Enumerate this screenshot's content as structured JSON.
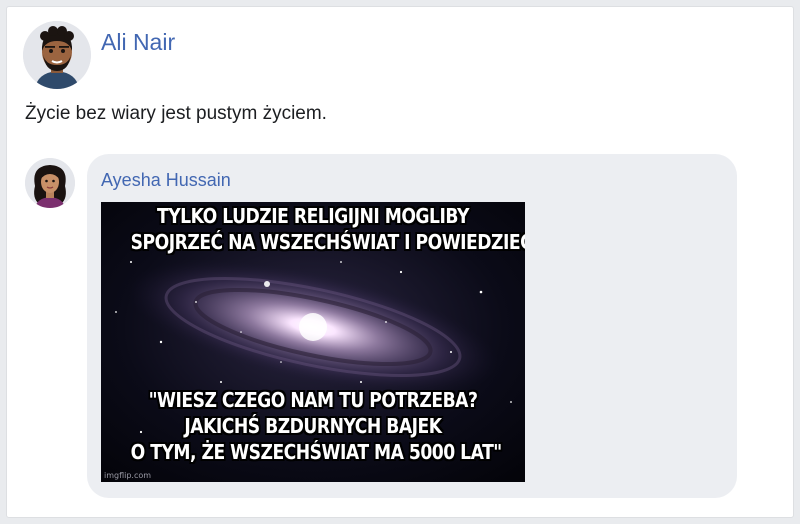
{
  "post": {
    "author": "Ali Nair",
    "text": "Życie bez wiary jest pustym życiem."
  },
  "comment": {
    "author": "Ayesha Hussain",
    "meme": {
      "top_lines": [
        "TYLKO LUDZIE RELIGIJNI MOGLIBY",
        "SPOJRZEĆ NA WSZECHŚWIAT I POWIEDZIEĆ:"
      ],
      "bottom_lines": [
        "\"WIESZ CZEGO NAM TU POTRZEBA?",
        "JAKICHŚ BZDURNYCH BAJEK",
        "O TYM, ŻE WSZECHŚWIAT MA 5000 LAT\""
      ],
      "watermark": "imgflip.com"
    }
  },
  "colors": {
    "link": "#4267b2",
    "text": "#1c1e21",
    "bubble": "#eceef2"
  }
}
